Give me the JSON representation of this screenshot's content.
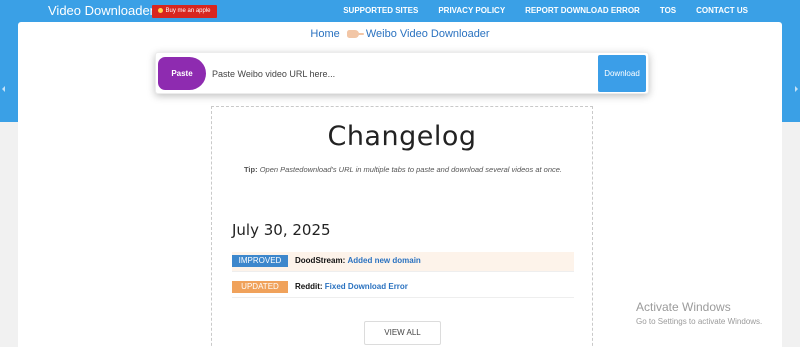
{
  "header": {
    "brand": "Video Downloader",
    "buy_me": "Buy me an apple",
    "nav": [
      "SUPPORTED SITES",
      "PRIVACY POLICY",
      "REPORT DOWNLOAD ERROR",
      "TOS",
      "CONTACT US"
    ]
  },
  "breadcrumb": {
    "home": "Home",
    "current": "Weibo Video Downloader"
  },
  "urlbar": {
    "paste_label": "Paste",
    "placeholder": "Paste Weibo video URL here...",
    "value": "",
    "download_label": "Download"
  },
  "changelog": {
    "title": "Changelog",
    "tip_label": "Tip:",
    "tip_text": "Open Pastedownload's URL in multiple tabs to paste and download several videos at once.",
    "date": "July 30, 2025",
    "entries": [
      {
        "badge": "IMPROVED",
        "site": "DoodStream:",
        "text": "Added new domain",
        "color": "#3d87cc"
      },
      {
        "badge": "UPDATED",
        "site": "Reddit:",
        "text": "Fixed Download Error",
        "color": "#f0a25b"
      }
    ],
    "view_all": "VIEW ALL"
  },
  "watermark": {
    "title": "Activate Windows",
    "subtitle": "Go to Settings to activate Windows."
  },
  "colors": {
    "header_blue": "#3aa0e6",
    "paste_purple": "#8e2bb0",
    "download_blue": "#3b9ee8",
    "link_blue": "#2a72c0"
  }
}
